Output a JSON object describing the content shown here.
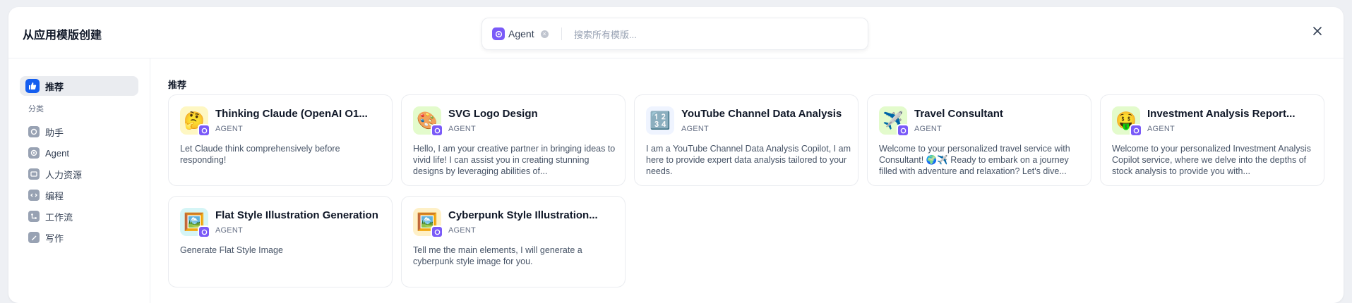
{
  "header": {
    "title": "从应用模版创建"
  },
  "search": {
    "chip_label": "Agent",
    "placeholder": "搜索所有模版..."
  },
  "sidebar": {
    "recommend": "推荐",
    "category_label": "分类",
    "items": [
      {
        "label": "助手",
        "icon": "assistant-icon"
      },
      {
        "label": "Agent",
        "icon": "agent-icon"
      },
      {
        "label": "人力资源",
        "icon": "hr-icon"
      },
      {
        "label": "编程",
        "icon": "code-icon"
      },
      {
        "label": "工作流",
        "icon": "workflow-icon"
      },
      {
        "label": "写作",
        "icon": "writing-icon"
      }
    ]
  },
  "main": {
    "section_title": "推荐",
    "cards": [
      {
        "name": "Thinking Claude (OpenAI O1...",
        "type": "AGENT",
        "desc": "Let Claude think comprehensively before responding!",
        "emoji": "🤔",
        "bg": "#fef7c3"
      },
      {
        "name": "SVG Logo Design",
        "type": "AGENT",
        "desc": "Hello, I am your creative partner in bringing ideas to vivid life! I can assist you in creating stunning designs by leveraging abilities of...",
        "emoji": "🎨",
        "bg": "#e3fbcc"
      },
      {
        "name": "YouTube Channel Data Analysis",
        "type": "AGENT",
        "desc": "I am a YouTube Channel Data Analysis Copilot, I am here to provide expert data analysis tailored to your needs.",
        "emoji": "🔢",
        "bg": "#eff4ff"
      },
      {
        "name": "Travel Consultant",
        "type": "AGENT",
        "desc": "Welcome to your personalized travel service with Consultant! 🌍✈️ Ready to embark on a journey filled with adventure and relaxation? Let's dive...",
        "emoji": "✈️",
        "bg": "#e3fbcc"
      },
      {
        "name": "Investment Analysis Report...",
        "type": "AGENT",
        "desc": "Welcome to your personalized Investment Analysis Copilot service, where we delve into the depths of stock analysis to provide you with...",
        "emoji": "🤑",
        "bg": "#e3fbcc"
      },
      {
        "name": "Flat Style Illustration Generation",
        "type": "AGENT",
        "desc": "Generate Flat Style Image",
        "emoji": "🖼️",
        "bg": "#d5f5f6"
      },
      {
        "name": "Cyberpunk Style Illustration...",
        "type": "AGENT",
        "desc": "Tell me the main elements, I will generate a cyberpunk style image for you.",
        "emoji": "🖼️",
        "bg": "#fef0c7"
      }
    ]
  },
  "colors": {
    "accent": "#155eef",
    "agent_badge": "#7a5af8"
  }
}
